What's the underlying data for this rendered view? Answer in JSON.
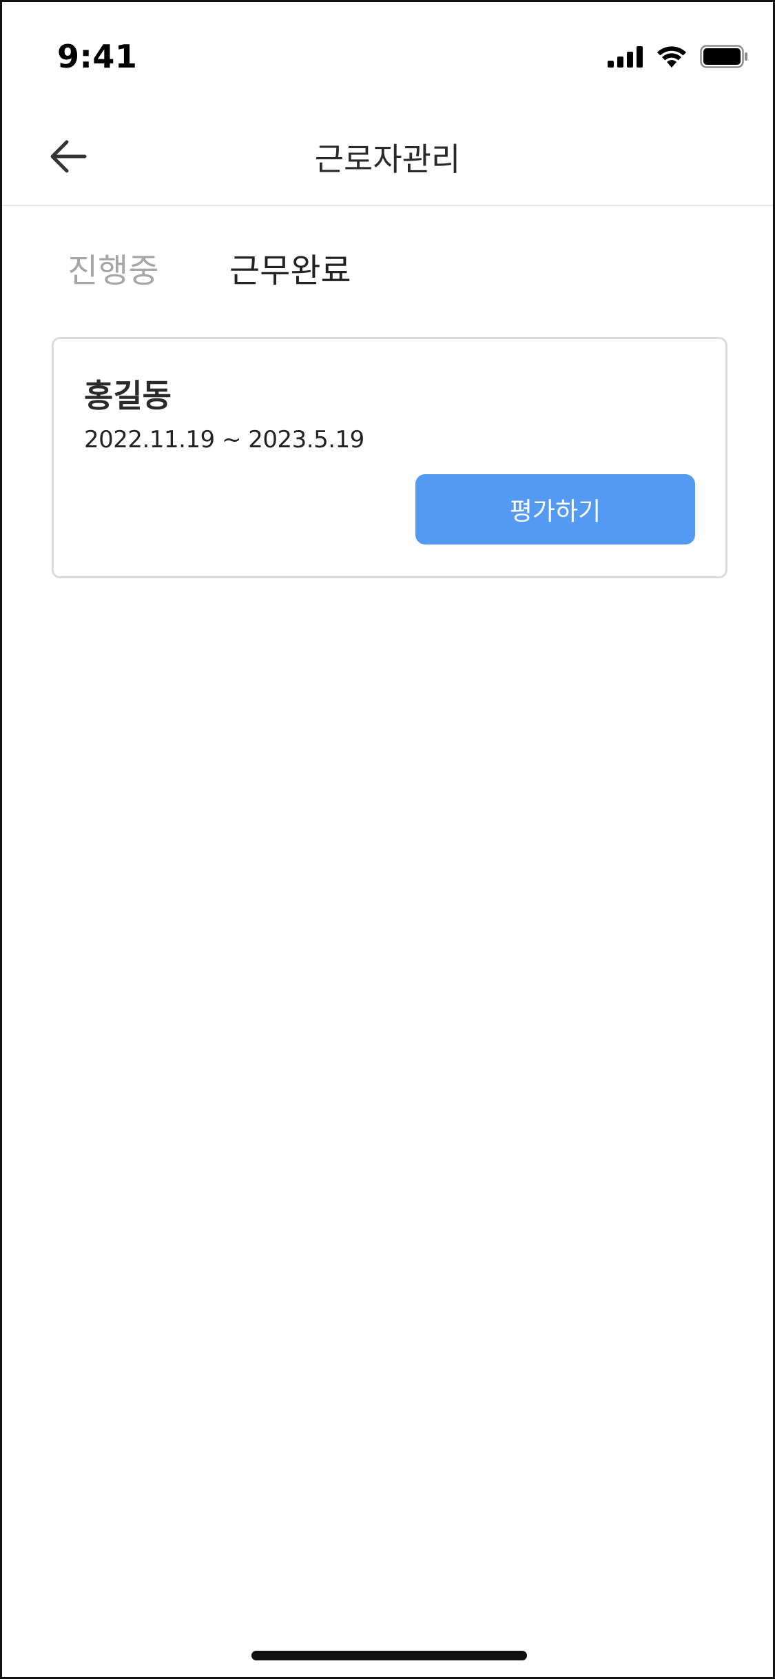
{
  "status_bar": {
    "time": "9:41",
    "icons": [
      "cellular-signal-icon",
      "wifi-icon",
      "battery-icon"
    ]
  },
  "header": {
    "title": "근로자관리",
    "back_icon": "arrow-left-icon"
  },
  "tabs": [
    {
      "label": "진행중",
      "active": false
    },
    {
      "label": "근무완료",
      "active": true
    }
  ],
  "workers": [
    {
      "name": "홍길동",
      "period": "2022.11.19 ~ 2023.5.19",
      "action_label": "평가하기"
    }
  ],
  "colors": {
    "accent": "#559af2",
    "tab_inactive": "#a6a6a6",
    "text_primary": "#222222",
    "card_border": "#dcdcdc"
  }
}
